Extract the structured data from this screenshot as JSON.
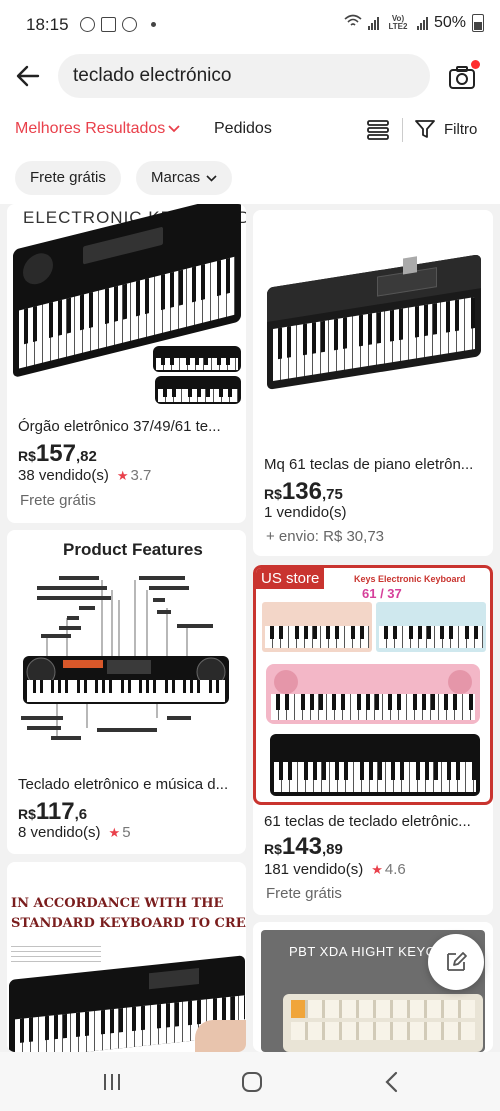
{
  "status_bar": {
    "time": "18:15",
    "lte_label": "Vo) LTE2",
    "battery": "50%"
  },
  "search": {
    "query": "teclado electrónico"
  },
  "sort": {
    "best": "Melhores Resultados",
    "orders": "Pedidos",
    "filter": "Filtro"
  },
  "chips": [
    "Frete grátis",
    "Marcas"
  ],
  "products": [
    {
      "title": "Órgão eletrônico 37/49/61 te...",
      "image_text": "ELECTRONIC KEYBOARD",
      "price_currency": "R$",
      "price_int": "157",
      "price_dec": ",82",
      "sold": "38  vendido(s)",
      "rating": "3.7",
      "extra": "Frete grátis"
    },
    {
      "title": "Mq 61 teclas de piano eletrôn...",
      "price_currency": "R$",
      "price_int": "136",
      "price_dec": ",75",
      "sold": "1  vendido(s)",
      "extra": "+ envio: R$ 30,73"
    },
    {
      "title": "Teclado eletrônico e música d...",
      "image_text": "Product Features",
      "price_currency": "R$",
      "price_int": "117",
      "price_dec": ",6",
      "sold": "8  vendido(s)",
      "rating": "5"
    },
    {
      "title": "61 teclas de teclado eletrônic...",
      "badge": "US store",
      "image_text": "Keys   Electronic Keyboard",
      "image_sub": "61 / 37",
      "price_currency": "R$",
      "price_int": "143",
      "price_dec": ",89",
      "sold": "181  vendido(s)",
      "rating": "4.6",
      "extra": "Frete grátis"
    },
    {
      "image_text_1": "IN ACCORDANCE WITH THE",
      "image_text_2": "STANDARD KEYBOARD TO CREATE"
    },
    {
      "image_text": "PBT XDA HIGHT KEYCA"
    }
  ],
  "colors": {
    "accent": "#e9404b",
    "badge_border": "#c9342f"
  }
}
